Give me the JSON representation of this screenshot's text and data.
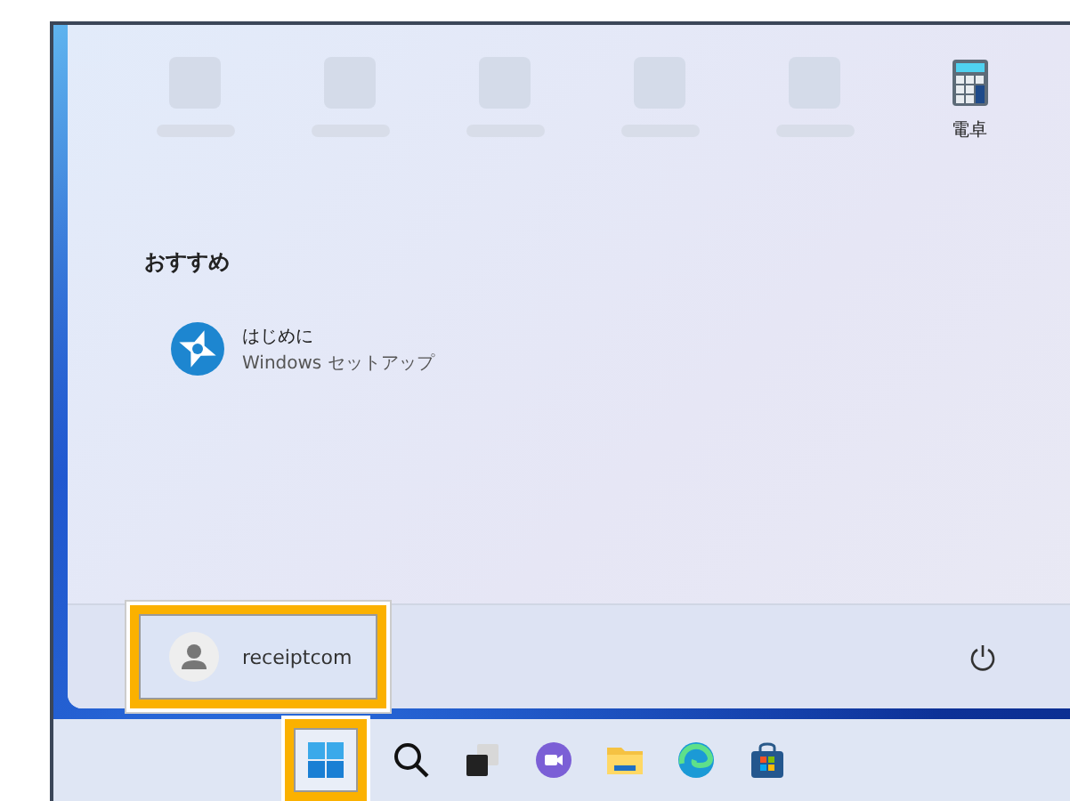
{
  "pinned": [
    {
      "kind": "placeholder"
    },
    {
      "kind": "placeholder"
    },
    {
      "kind": "placeholder"
    },
    {
      "kind": "placeholder"
    },
    {
      "kind": "placeholder"
    },
    {
      "kind": "calculator",
      "label": "電卓"
    }
  ],
  "recommended": {
    "title": "おすすめ",
    "items": [
      {
        "kind": "setup",
        "title": "はじめに",
        "subtitle": "Windows セットアップ"
      }
    ]
  },
  "user": {
    "name": "receiptcom",
    "highlighted": true
  },
  "taskbar": {
    "items": [
      {
        "kind": "start",
        "highlighted": true
      },
      {
        "kind": "search",
        "highlighted": false
      },
      {
        "kind": "taskview",
        "highlighted": false
      },
      {
        "kind": "chat",
        "highlighted": false
      },
      {
        "kind": "explorer",
        "highlighted": false
      },
      {
        "kind": "edge",
        "highlighted": false
      },
      {
        "kind": "store",
        "highlighted": false
      }
    ]
  }
}
